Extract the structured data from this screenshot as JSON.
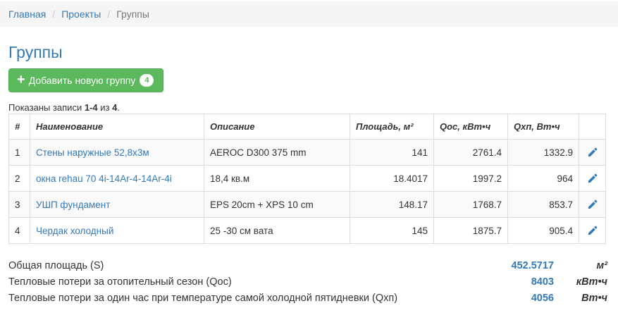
{
  "breadcrumb": {
    "home": "Главная",
    "projects": "Проекты",
    "current": "Группы",
    "separator": "/"
  },
  "page": {
    "title": "Группы"
  },
  "add_button": {
    "label": "Добавить новую группу",
    "count": "4",
    "icon": "plus-icon"
  },
  "summary": {
    "prefix": "Показаны записи ",
    "range": "1-4",
    "middle": " из ",
    "total": "4",
    "suffix": "."
  },
  "table": {
    "headers": [
      "#",
      "Наименование",
      "Описание",
      "Площадь, м²",
      "Qoc, кВт•ч",
      "Qхп, Вт•ч"
    ],
    "rows": [
      {
        "num": "1",
        "name": "Стены наружные 52,8х3м",
        "desc": "AEROC D300 375 mm",
        "area": "141",
        "qoc": "2761.4",
        "qxp": "1332.9"
      },
      {
        "num": "2",
        "name": "окна rehau 70 4i-14Ar-4-14Ar-4i",
        "desc": "18,4 кв.м",
        "area": "18.4017",
        "qoc": "1997.2",
        "qxp": "964"
      },
      {
        "num": "3",
        "name": "УШП фундамент",
        "desc": "EPS 20cm + XPS 10 cm",
        "area": "148.17",
        "qoc": "1768.7",
        "qxp": "853.7"
      },
      {
        "num": "4",
        "name": "Чердак холодный",
        "desc": "25 -30 см вата",
        "area": "145",
        "qoc": "1875.7",
        "qxp": "905.4"
      }
    ],
    "edit_icon": "pencil-icon"
  },
  "totals": [
    {
      "label": "Общая площадь (S)",
      "value": "452.5717",
      "unit": "м²"
    },
    {
      "label": "Тепловые потери за отопительный сезон (Qoc)",
      "value": "8403",
      "unit": "кВт•ч"
    },
    {
      "label": "Тепловые потери за один час при температуре самой холодной пятидневки (Qхп)",
      "value": "4056",
      "unit": "Вт•ч"
    }
  ],
  "colors": {
    "link": "#337ab7",
    "button": "#5cb85c",
    "breadcrumb_bg": "#f5f5f5"
  }
}
